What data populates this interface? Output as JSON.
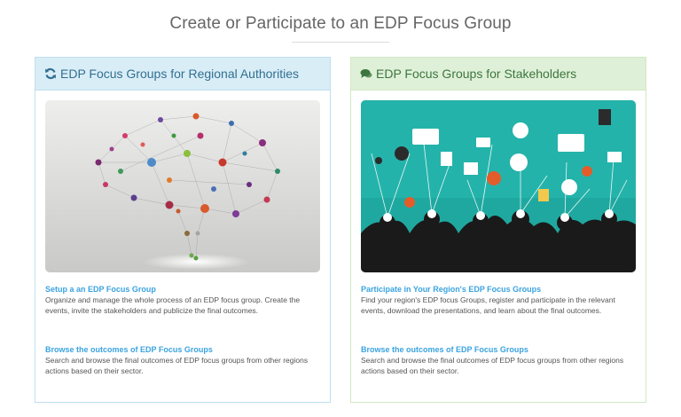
{
  "page": {
    "title": "Create or Participate to an EDP Focus Group"
  },
  "left_panel": {
    "heading": "EDP Focus Groups for Regional Authorities",
    "icon": "refresh-icon",
    "accent": "#31708f",
    "sections": [
      {
        "link": "Setup a an EDP Focus Group",
        "text": "Organize and manage the whole process of an EDP focus group. Create the events, invite the stakeholders and publicize the final outcomes."
      },
      {
        "link": "Browse the outcomes of EDP Focus Groups",
        "text": "Search and browse the final outcomes of EDP focus groups from other regions actions based on their sector."
      }
    ]
  },
  "right_panel": {
    "heading": "EDP Focus Groups for Stakeholders",
    "icon": "comments-icon",
    "accent": "#3c763d",
    "sections": [
      {
        "link": "Participate in Your Region's EDP Focus Groups",
        "text": "Find your region's EDP focus Groups, register and participate in the relevant events, download the presentations, and learn about the final outcomes."
      },
      {
        "link": "Browse the outcomes of EDP Focus Groups",
        "text": "Search and browse the final outcomes of EDP focus groups from other regions actions based on their sector."
      }
    ]
  }
}
